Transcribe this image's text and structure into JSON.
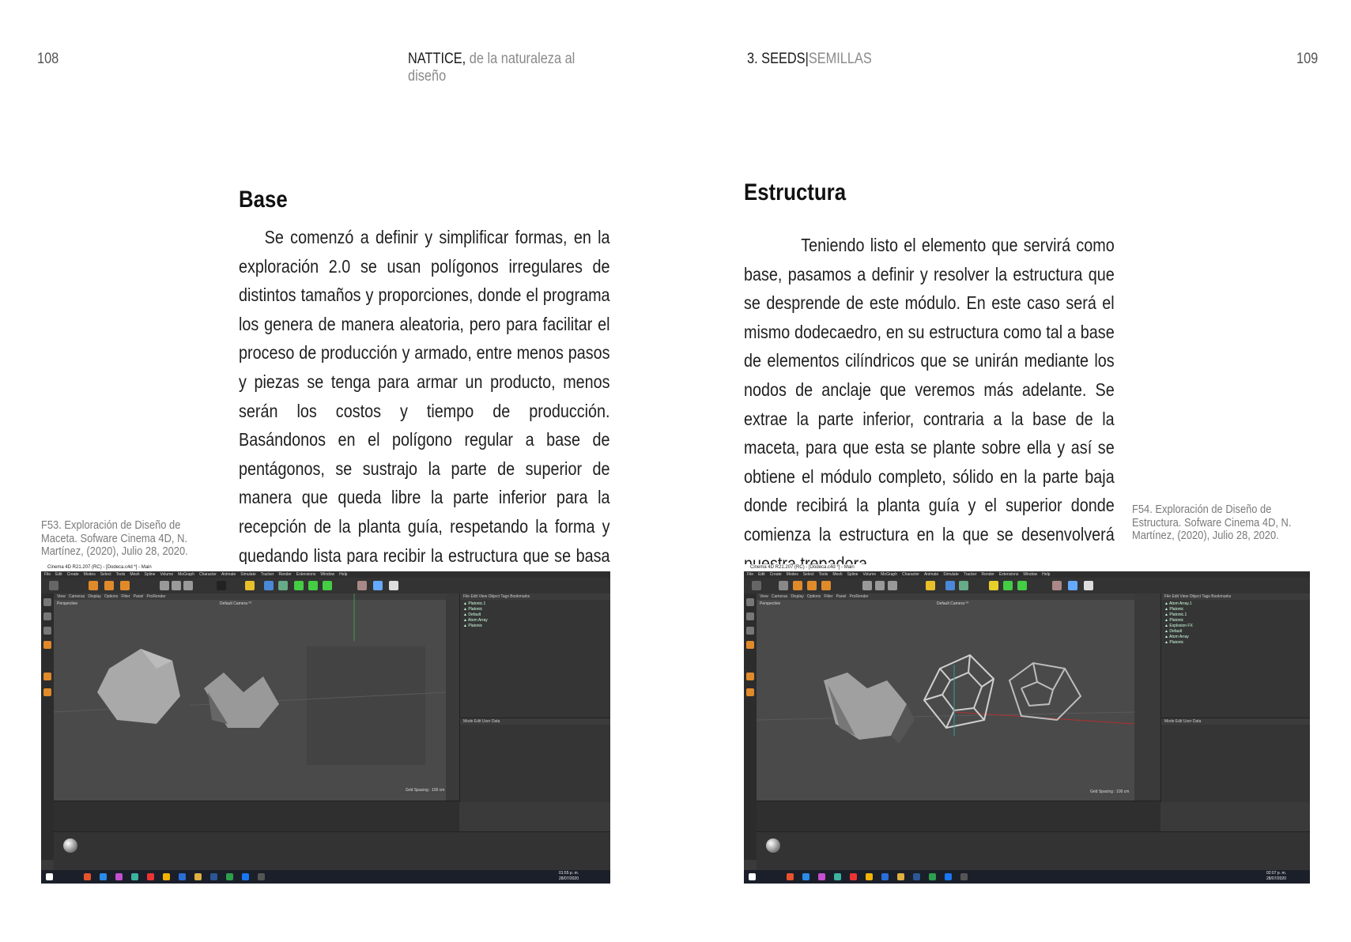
{
  "left_page": {
    "number": "108",
    "header_strong": "NATTICE,",
    "header_light": " de la naturaleza al diseño",
    "heading": "Base",
    "body": "Se comenzó a definir y simplificar formas, en la exploración 2.0 se usan polígonos irregulares de distintos tamaños y proporciones, donde el programa los genera de manera aleatoria, pero para facilitar el proceso de producción y armado, entre menos pasos y piezas se tenga para armar un producto, menos serán los costos y tiempo de producción. Basándonos en el polígono regular a base de pentágonos, se sustrajo la parte de superior de manera que queda libre la parte inferior para la recepción de la planta guía, respetando la forma y quedando lista para recibir la estructura que se basa de igual manera en un dodecaedro.",
    "caption": "F53. Exploración de Diseño de Maceta. Sofware Cinema 4D, N. Martínez, (2020), Julio 28, 2020.",
    "screenshot": {
      "window_title": "Cinema 4D R21.207 (RC) - [Dodeca.c4d *] - Main",
      "viewport_label": "Perspective",
      "camera_label": "Default Camera ⁰⁰",
      "grid_spacing": "Grid Spacing : 100 cm",
      "menu": [
        "File",
        "Edit",
        "Create",
        "Modes",
        "Select",
        "Tools",
        "Mesh",
        "Spline",
        "Volume",
        "MoGraph",
        "Character",
        "Animate",
        "Simulate",
        "Tracker",
        "Render",
        "Extensions",
        "Window",
        "Help"
      ],
      "objects": [
        "Platonic.1",
        "Platonic",
        "Default",
        "Atom Array",
        "Platonic"
      ],
      "clock": "01:55 p. m.",
      "date": "28/07/2020"
    }
  },
  "right_page": {
    "number": "109",
    "header_strong": "3. SEEDS",
    "header_sep": "|",
    "header_light": "SEMILLAS",
    "heading": "Estructura",
    "body": "Teniendo listo el elemento que servirá como base, pasamos a definir y resolver la estructura que se desprende de este módulo. En este caso será el mismo dodecaedro, en su estructura como tal a base de elementos cilíndricos que se unirán mediante los nodos de anclaje que veremos más adelante. Se extrae la parte inferior, contraria a la base de la maceta, para que esta se plante sobre ella y así se obtiene el módulo completo, sólido en la parte baja donde recibirá la planta guía y el superior donde comienza la estructura en la que se desenvolverá nuestra trepadora.",
    "caption": "F54. Exploración de Diseño de Estructura. Sofware Cinema 4D, N. Martínez, (2020), Julio 28, 2020.",
    "screenshot": {
      "window_title": "Cinema 4D R21.207 (RC) - [Dodeca.c4d *] - Main",
      "viewport_label": "Perspective",
      "camera_label": "Default Camera ⁰⁰",
      "grid_spacing": "Grid Spacing : 100 cm",
      "menu": [
        "File",
        "Edit",
        "Create",
        "Modes",
        "Select",
        "Tools",
        "Mesh",
        "Spline",
        "Volume",
        "MoGraph",
        "Character",
        "Animate",
        "Simulate",
        "Tracker",
        "Render",
        "Extensions",
        "Window",
        "Help"
      ],
      "objects": [
        "Atom Array.1",
        "Platonic",
        "Platonic.1",
        "Platonic",
        "Explosion FX",
        "Default",
        "Atom Array",
        "Platonic"
      ],
      "clock": "02:07 p. m.",
      "date": "28/07/2020"
    }
  }
}
